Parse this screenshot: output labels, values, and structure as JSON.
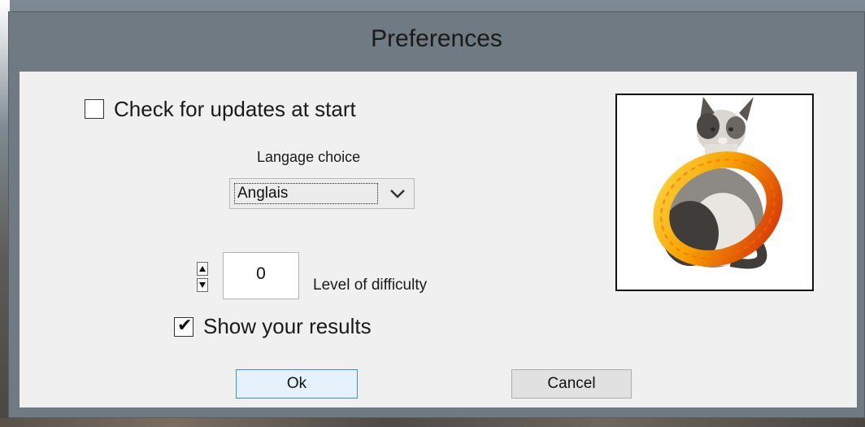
{
  "window": {
    "title": "Preferences"
  },
  "options": {
    "check_updates_label": "Check for updates at start",
    "check_updates_checked": false,
    "language_label": "Langage choice",
    "language_selected": "Anglais",
    "difficulty_value": "0",
    "difficulty_label": "Level of difficulty",
    "show_results_label": "Show your results",
    "show_results_checked": true
  },
  "buttons": {
    "ok": "Ok",
    "cancel": "Cancel"
  },
  "icons": {
    "dropdown": "chevron-down-icon",
    "spin_up": "triangle-up-icon",
    "spin_down": "triangle-down-icon",
    "check": "checkmark-icon"
  },
  "colors": {
    "title_bar": "#6f7a83",
    "client_bg": "#f0f0f0",
    "default_button_border": "#3c8fdc",
    "ring_gold": "#f5a000",
    "ring_red": "#d42a08"
  }
}
